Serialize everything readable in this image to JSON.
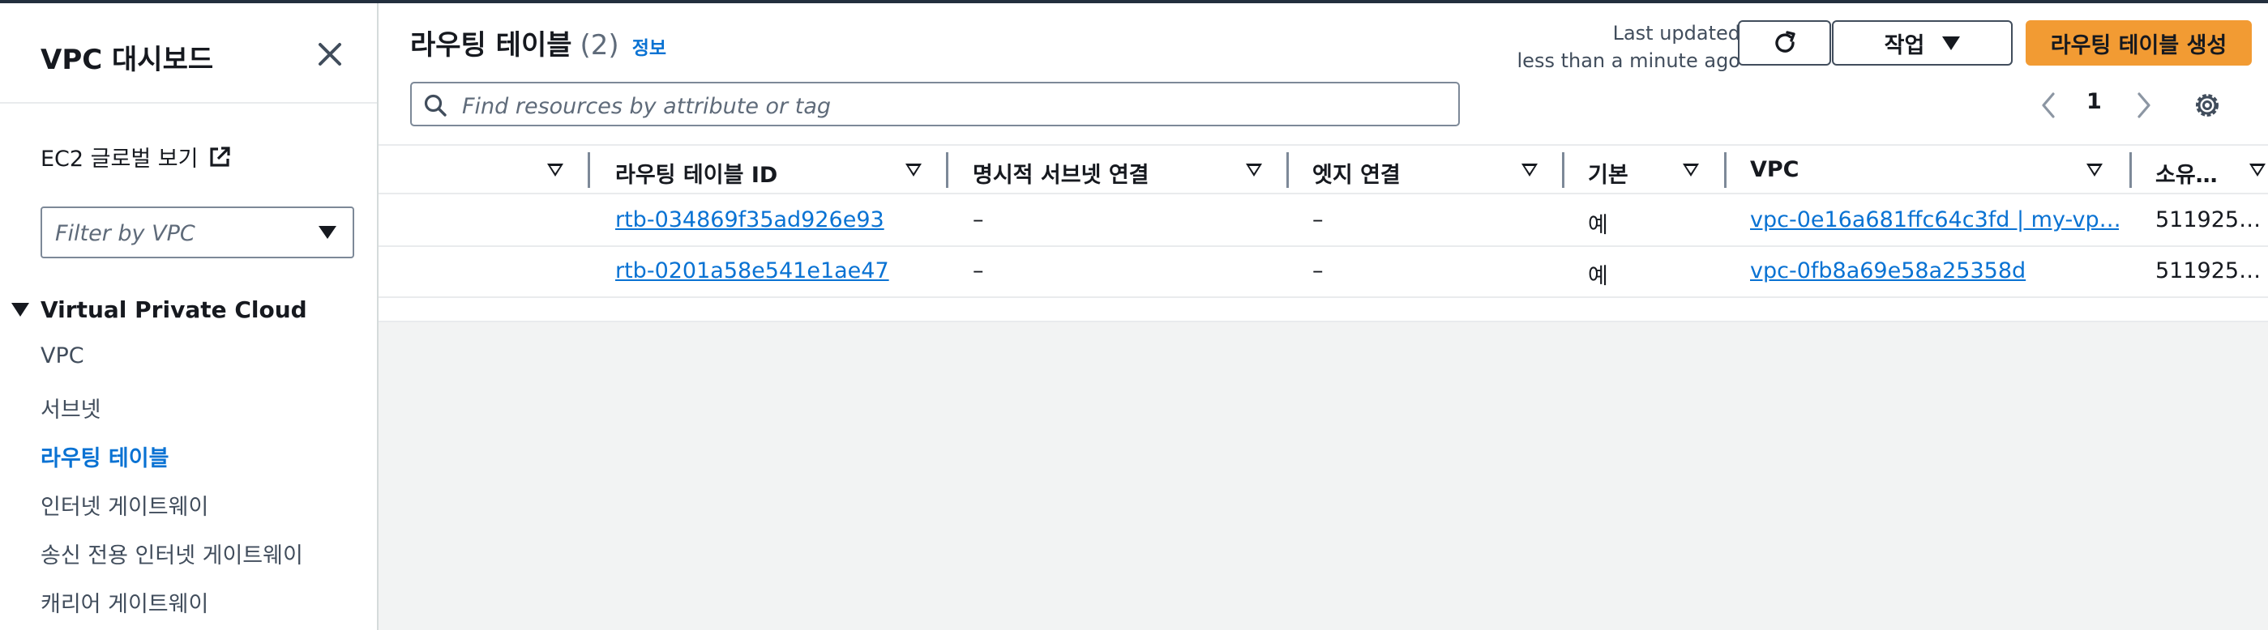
{
  "sidebar": {
    "title": "VPC 대시보드",
    "ec2_link": "EC2 글로벌 보기",
    "filter_placeholder": "Filter by VPC",
    "section": "Virtual Private Cloud",
    "items": [
      {
        "label": "VPC",
        "active": false
      },
      {
        "label": "서브넷",
        "active": false
      },
      {
        "label": "라우팅 테이블",
        "active": true
      },
      {
        "label": "인터넷 게이트웨이",
        "active": false
      },
      {
        "label": "송신 전용 인터넷 게이트웨이",
        "active": false
      },
      {
        "label": "캐리어 게이트웨이",
        "active": false
      }
    ]
  },
  "header": {
    "title": "라우팅 테이블",
    "count": "(2)",
    "info": "정보",
    "updated_line1": "Last updated",
    "updated_line2": "less than a minute ago",
    "action_label": "작업",
    "create_label": "라우팅 테이블 생성"
  },
  "search": {
    "placeholder": "Find resources by attribute or tag"
  },
  "pagination": {
    "page": "1"
  },
  "table": {
    "columns": [
      "라우팅 테이블 ID",
      "명시적 서브넷 연결",
      "엣지 연결",
      "기본",
      "VPC",
      "소유…"
    ],
    "rows": [
      {
        "id": "rtb-034869f35ad926e93",
        "subnet": "–",
        "edge": "–",
        "main": "예",
        "vpc": "vpc-0e16a681ffc64c3fd | my-vp…",
        "owner": "511925…"
      },
      {
        "id": "rtb-0201a58e541e1ae47",
        "subnet": "–",
        "edge": "–",
        "main": "예",
        "vpc": "vpc-0fb8a69e58a25358d",
        "owner": "511925…"
      }
    ]
  },
  "colors": {
    "accent": "#0972d3",
    "primary_button": "#f29b33",
    "background": "#f2f3f3"
  },
  "icons": [
    "close-icon",
    "external-link-icon",
    "search-icon",
    "refresh-icon",
    "chevron-left-icon",
    "chevron-right-icon",
    "settings-icon"
  ]
}
